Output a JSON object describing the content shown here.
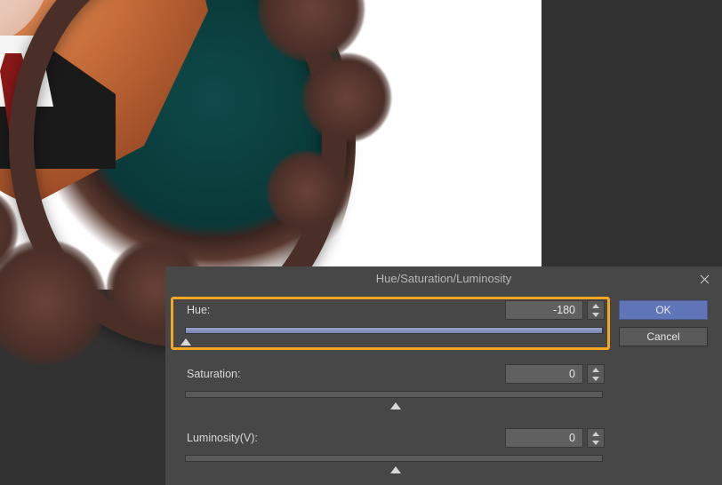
{
  "dialog": {
    "title": "Hue/Saturation/Luminosity",
    "ok_label": "OK",
    "cancel_label": "Cancel",
    "hue": {
      "label": "Hue:",
      "value": "-180",
      "percent": 0
    },
    "saturation": {
      "label": "Saturation:",
      "value": "0",
      "percent": 50
    },
    "luminosity": {
      "label": "Luminosity(V):",
      "value": "0",
      "percent": 50
    }
  }
}
